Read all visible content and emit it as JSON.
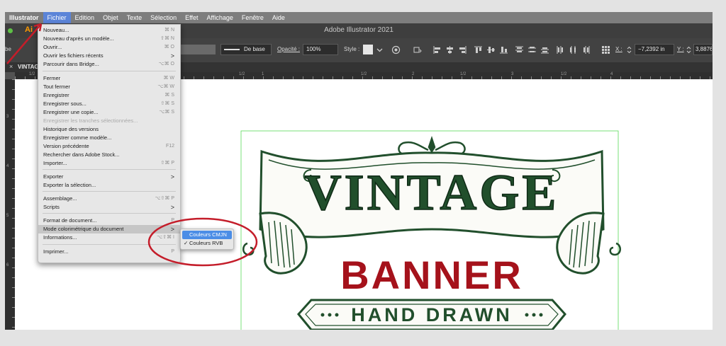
{
  "menubar": {
    "items": [
      "Illustrator",
      "Fichier",
      "Edition",
      "Objet",
      "Texte",
      "Sélection",
      "Effet",
      "Affichage",
      "Fenêtre",
      "Aide"
    ]
  },
  "window": {
    "title": "Adobe Illustrator 2021"
  },
  "control_bar": {
    "left_fragment": "be",
    "stroke_style": "De base",
    "opacity_label": "Opacité :",
    "opacity_value": "100%",
    "style_label": "Style :",
    "x_label": "X :",
    "x_value": "−7,2392 in",
    "y_label": "Y :",
    "y_value": "3,8876 i"
  },
  "tab": {
    "name": "VINTAG",
    "close": "×"
  },
  "rulers": {
    "h_ticks": [
      "1/2",
      "1/2",
      "1",
      "1/2",
      "2",
      "1/2",
      "3",
      "1/2",
      "4"
    ],
    "v_ticks": [
      "3",
      "4",
      "5",
      "6"
    ]
  },
  "file_menu": {
    "items": [
      {
        "label": "Nouveau...",
        "shortcut": "⌘ N"
      },
      {
        "label": "Nouveau d'après un modèle...",
        "shortcut": "⇧⌘ N"
      },
      {
        "label": "Ouvrir...",
        "shortcut": "⌘ O"
      },
      {
        "label": "Ouvrir les fichiers récents",
        "shortcut": ">"
      },
      {
        "label": "Parcourir dans Bridge...",
        "shortcut": "⌥⌘ O"
      },
      {
        "label": "Fermer",
        "shortcut": "⌘ W"
      },
      {
        "label": "Tout fermer",
        "shortcut": "⌥⌘ W"
      },
      {
        "label": "Enregistrer",
        "shortcut": "⌘ S"
      },
      {
        "label": "Enregistrer sous...",
        "shortcut": "⇧⌘ S"
      },
      {
        "label": "Enregistrer une copie...",
        "shortcut": "⌥⌘ S"
      },
      {
        "label": "Enregistrer les tranches sélectionnées...",
        "shortcut": ""
      },
      {
        "label": "Historique des versions",
        "shortcut": ""
      },
      {
        "label": "Enregistrer comme modèle...",
        "shortcut": ""
      },
      {
        "label": "Version précédente",
        "shortcut": "F12"
      },
      {
        "label": "Rechercher dans Adobe Stock...",
        "shortcut": ""
      },
      {
        "label": "Importer...",
        "shortcut": "⇧⌘ P"
      },
      {
        "label": "Exporter",
        "shortcut": ">"
      },
      {
        "label": "Exporter la sélection...",
        "shortcut": ""
      },
      {
        "label": "Assemblage...",
        "shortcut": "⌥⇧⌘ P"
      },
      {
        "label": "Scripts",
        "shortcut": ">"
      },
      {
        "label": "Format de document...",
        "shortcut": "P"
      },
      {
        "label": "Mode colorimétrique du document",
        "shortcut": ">"
      },
      {
        "label": "Informations...",
        "shortcut": "⌥⇧⌘ I"
      },
      {
        "label": "Imprimer...",
        "shortcut": "P"
      }
    ]
  },
  "color_mode_submenu": {
    "items": [
      {
        "label": "Couleurs CMJN",
        "checked": false,
        "selected": true
      },
      {
        "label": "Couleurs RVB",
        "checked": true,
        "selected": false
      }
    ],
    "check_glyph": "✓"
  },
  "artwork": {
    "line1": "VINTAGE",
    "line2": "BANNER",
    "line3": "HAND DRAWN",
    "colors": {
      "green": "#214f2c",
      "red": "#a5121b",
      "guide": "#57d957"
    }
  },
  "annotation_color": "#c41d2a"
}
